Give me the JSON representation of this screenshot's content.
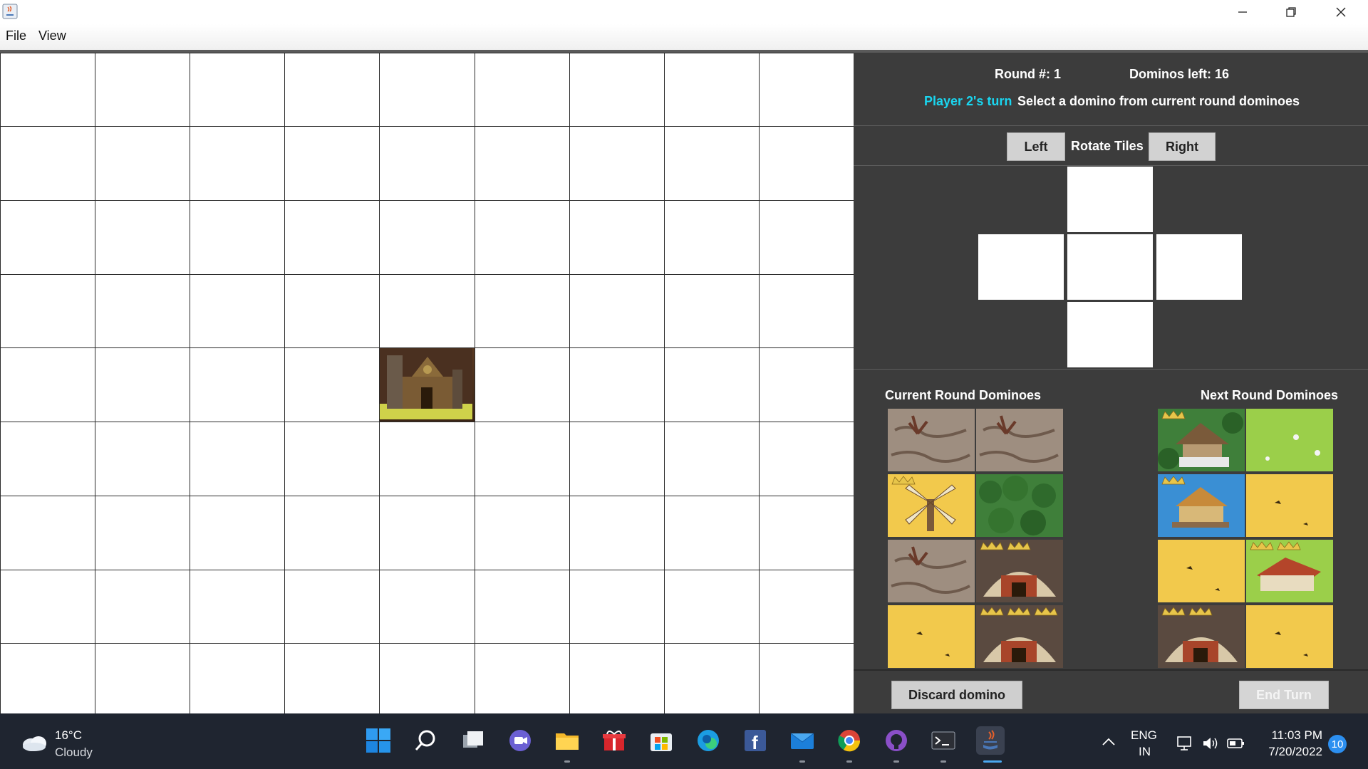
{
  "window": {
    "title": "",
    "menu": [
      "File",
      "View"
    ]
  },
  "status": {
    "round_label": "Round #: 1",
    "dominos_left_label": "Dominos left: 16",
    "player_turn": "Player 2's turn",
    "instruction": "Select a domino from current round dominoes"
  },
  "rotate": {
    "left_label": "Left",
    "title": "Rotate Tiles",
    "right_label": "Right"
  },
  "sections": {
    "current_title": "Current Round Dominoes",
    "next_title": "Next Round Dominoes"
  },
  "current_dominoes": [
    {
      "left": {
        "terrain": "swamp",
        "crowns": 0
      },
      "right": {
        "terrain": "swamp",
        "crowns": 0
      }
    },
    {
      "left": {
        "terrain": "wheat-windmill",
        "crowns": 1
      },
      "right": {
        "terrain": "forest",
        "crowns": 0
      }
    },
    {
      "left": {
        "terrain": "swamp",
        "crowns": 0
      },
      "right": {
        "terrain": "mine",
        "crowns": 2
      }
    },
    {
      "left": {
        "terrain": "wheat",
        "crowns": 0
      },
      "right": {
        "terrain": "mine",
        "crowns": 3
      }
    }
  ],
  "next_dominoes": [
    {
      "left": {
        "terrain": "forest-house",
        "crowns": 1
      },
      "right": {
        "terrain": "grassland",
        "crowns": 0
      }
    },
    {
      "left": {
        "terrain": "lake-house",
        "crowns": 1
      },
      "right": {
        "terrain": "wheat",
        "crowns": 0
      }
    },
    {
      "left": {
        "terrain": "wheat",
        "crowns": 0
      },
      "right": {
        "terrain": "grassland-house",
        "crowns": 2
      }
    },
    {
      "left": {
        "terrain": "mine",
        "crowns": 2
      },
      "right": {
        "terrain": "wheat",
        "crowns": 0
      }
    }
  ],
  "actions": {
    "discard_label": "Discard domino",
    "end_turn_label": "End Turn"
  },
  "board": {
    "cols": 9,
    "rows": 9,
    "castle_cell": {
      "col": 4,
      "row": 4
    }
  },
  "taskbar": {
    "weather_temp": "16°C",
    "weather_desc": "Cloudy",
    "lang_line1": "ENG",
    "lang_line2": "IN",
    "time": "11:03 PM",
    "date": "7/20/2022",
    "notification_count": "10"
  },
  "colors": {
    "player_highlight": "#1ad6f0",
    "panel_bg": "#3c3c3c",
    "taskbar_bg": "#1f2530",
    "wheat": "#f2c94c",
    "forest": "#3f7f3a",
    "swamp": "#9e8e80",
    "grassland": "#9bcf4a",
    "lake": "#3a8fd4",
    "mine": "#5a4a40"
  }
}
